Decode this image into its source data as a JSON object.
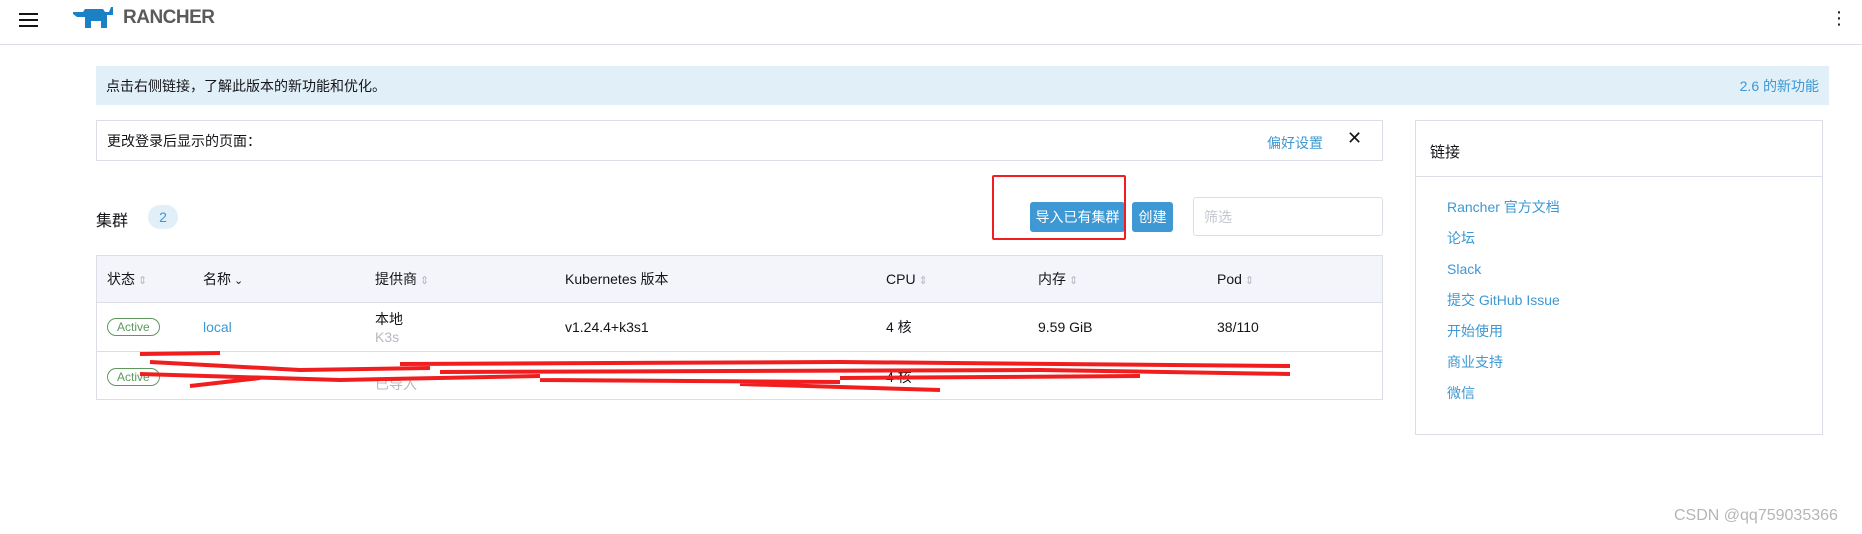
{
  "header": {
    "logo": "RANCHER",
    "menu_icon": "hamburger-icon",
    "more_icon": "kebab-icon"
  },
  "banner": {
    "text": "点击右侧链接，了解此版本的新功能和优化。",
    "link": "2.6 的新功能"
  },
  "pref": {
    "text": "更改登录后显示的页面：",
    "link": "偏好设置"
  },
  "clusters": {
    "title": "集群",
    "count": "2",
    "import_button": "导入已有集群",
    "create_button": "创建",
    "filter_placeholder": "筛选"
  },
  "table": {
    "columns": [
      "状态",
      "名称",
      "提供商",
      "Kubernetes 版本",
      "CPU",
      "内存",
      "Pod"
    ],
    "rows": [
      {
        "state": "Active",
        "name": "local",
        "provider": "本地",
        "provider_sub": "K3s",
        "version": "v1.24.4+k3s1",
        "cpu": "4 核",
        "memory": "9.59 GiB",
        "pods": "38/110"
      },
      {
        "state": "Active",
        "name": "",
        "provider": "",
        "provider_sub": "已导入",
        "version": "",
        "cpu": "4 核",
        "memory": "",
        "pods": ""
      }
    ]
  },
  "links": {
    "title": "链接",
    "items": [
      "Rancher 官方文档",
      "论坛",
      "Slack",
      "提交 GitHub Issue",
      "开始使用",
      "商业支持",
      "微信"
    ]
  },
  "watermark": "CSDN @qq759035366",
  "colors": {
    "accent": "#3d98d3",
    "active": "#5d995d",
    "annotation": "#f01e1e"
  }
}
